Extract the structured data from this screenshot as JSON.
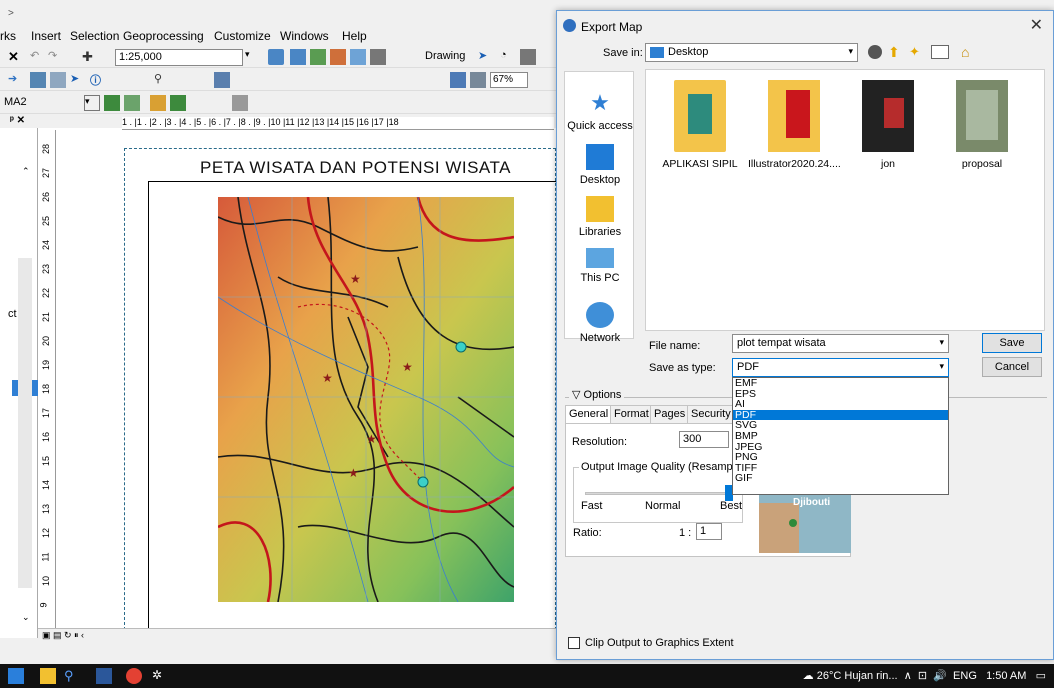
{
  "arcmap": {
    "menus": [
      "rks",
      "Insert",
      "Selection",
      "Geoprocessing",
      "Customize",
      "Windows",
      "Help"
    ],
    "scale": "1:25,000",
    "drawing_label": "Drawing",
    "zoom_pct": "67%",
    "layer_combo": "MA2",
    "left_panel_text": "ct",
    "map_title": "PETA WISATA DAN POTENSI WISATA",
    "ruler_top": "1 . |1 . |2 . |3 . |4 . |5 . |6 . |7 . |8 . |9 . |10 |11 |12 |13 |14 |15 |16 |17 |18",
    "ruler_left": [
      "28",
      "27",
      "26",
      "25",
      "24",
      "23",
      "22",
      "21",
      "20",
      "19",
      "18",
      "17",
      "16",
      "15",
      "14",
      "13",
      "12",
      "11",
      "10",
      "9"
    ]
  },
  "dialog": {
    "title": "Export Map",
    "save_in_label": "Save in:",
    "save_in_value": "Desktop",
    "places": [
      "Quick access",
      "Desktop",
      "Libraries",
      "This PC",
      "Network"
    ],
    "folders": [
      "APLIKASI SIPIL",
      "Illustrator2020.24....",
      "jon",
      "proposal"
    ],
    "file_name_label": "File name:",
    "file_name_value": "plot tempat wisata",
    "save_as_type_label": "Save as type:",
    "save_as_type_value": "PDF",
    "save_button": "Save",
    "cancel_button": "Cancel",
    "type_options": [
      "EMF",
      "EPS",
      "AI",
      "PDF",
      "SVG",
      "BMP",
      "JPEG",
      "PNG",
      "TIFF",
      "GIF"
    ],
    "selected_type": "PDF",
    "options_label": "Options",
    "tabs": [
      "General",
      "Format",
      "Pages",
      "Security"
    ],
    "resolution_label": "Resolution:",
    "resolution_value": "300",
    "quality_label": "Output Image Quality (Resample Ra",
    "quality_marks": [
      "Fast",
      "Normal",
      "Best"
    ],
    "ratio_label": "Ratio:",
    "ratio_prefix": "1 :",
    "ratio_value": "1",
    "preview_label": "Djibouti",
    "clip_label": "Clip Output to Graphics Extent"
  },
  "taskbar": {
    "weather": "26°C  Hujan rin...",
    "lang": "ENG",
    "time": "1:50 AM"
  }
}
